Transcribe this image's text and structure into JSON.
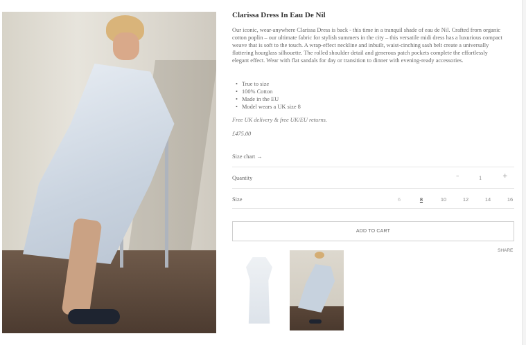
{
  "product": {
    "title": "Clarissa Dress In Eau De Nil",
    "description": "Our iconic, wear-anywhere Clarissa Dress is back - this time in a tranquil shade of eau de Nil. Crafted from organic cotton poplin – our ultimate fabric for stylish summers in the city – this versatile midi dress has a luxurious compact weave that is soft to the touch. A wrap-effect neckline and inbuilt, waist-cinching sash belt create a universally flattering hourglass silhouette. The rolled shoulder detail and generous patch pockets complete the effortlessly elegant effect. Wear with flat sandals for day or transition to dinner with evening-ready accessories.",
    "features": [
      "True to size",
      "100% Cotton",
      "Made in the EU",
      "Model wears a UK size 8"
    ],
    "delivery": "Free UK delivery & free UK/EU returns.",
    "price": "£475.00"
  },
  "size_chart_label": "Size chart →",
  "quantity": {
    "label": "Quantity",
    "minus": "–",
    "value": "1",
    "plus": "+"
  },
  "size": {
    "label": "Size",
    "options": [
      {
        "label": "6",
        "state": "disabled"
      },
      {
        "label": "8",
        "state": "selected"
      },
      {
        "label": "10",
        "state": "available"
      },
      {
        "label": "12",
        "state": "available"
      },
      {
        "label": "14",
        "state": "available"
      },
      {
        "label": "16",
        "state": "available"
      }
    ]
  },
  "add_to_cart_label": "ADD TO CART",
  "share_label": "SHARE",
  "images": {
    "hero_alt": "model-seated-in-dress",
    "thumbnails": [
      "dress-flat-thumbnail",
      "model-seated-thumbnail"
    ]
  }
}
